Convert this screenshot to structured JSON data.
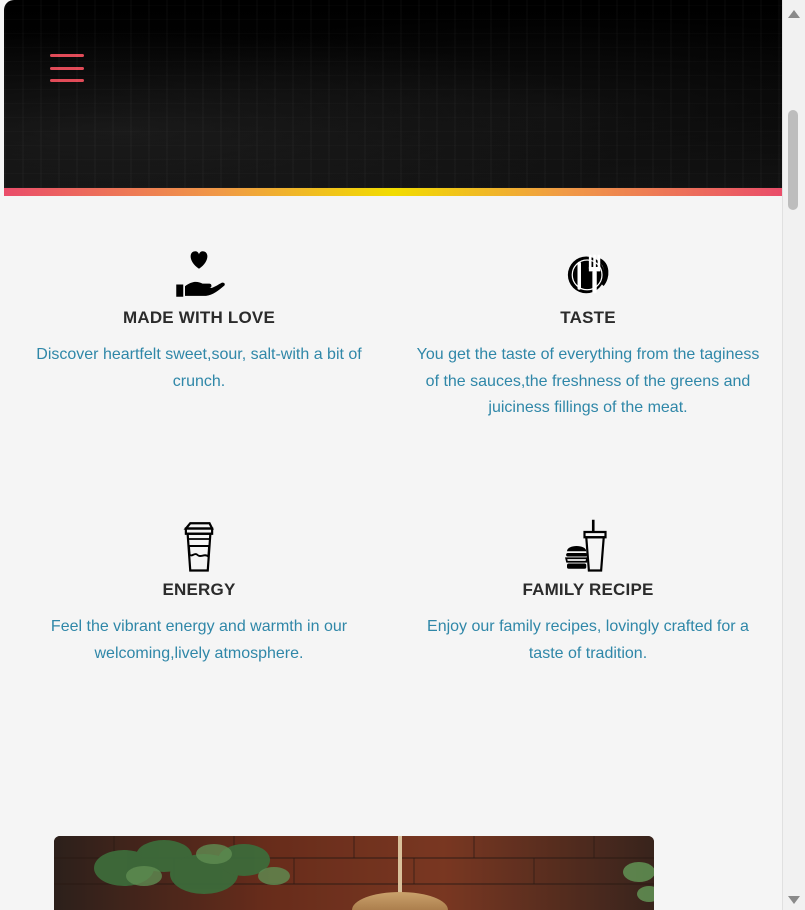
{
  "header": {
    "menu_icon": "hamburger-icon",
    "accent_gradient": [
      "#ea4d6a",
      "#f09a46",
      "#f1dc00"
    ]
  },
  "features": [
    {
      "icon": "hand-heart-icon",
      "title": "MADE WITH LOVE",
      "description": "Discover heartfelt sweet,sour, salt-with a bit of crunch."
    },
    {
      "icon": "fork-plate-icon",
      "title": "TASTE",
      "description": "You get the taste of everything from the taginess of the sauces,the freshness of the greens and juiciness fillings of the meat."
    },
    {
      "icon": "coffee-cup-icon",
      "title": "ENERGY",
      "description": "Feel the vibrant energy and warmth in our welcoming,lively atmosphere."
    },
    {
      "icon": "burger-drink-icon",
      "title": "FAMILY RECIPE",
      "description": "Enjoy our family recipes, lovingly crafted for a taste of tradition."
    }
  ],
  "colors": {
    "title": "#2b2b2b",
    "description": "#2f87a8",
    "menu": "#e14b58",
    "background": "#f5f5f5"
  }
}
